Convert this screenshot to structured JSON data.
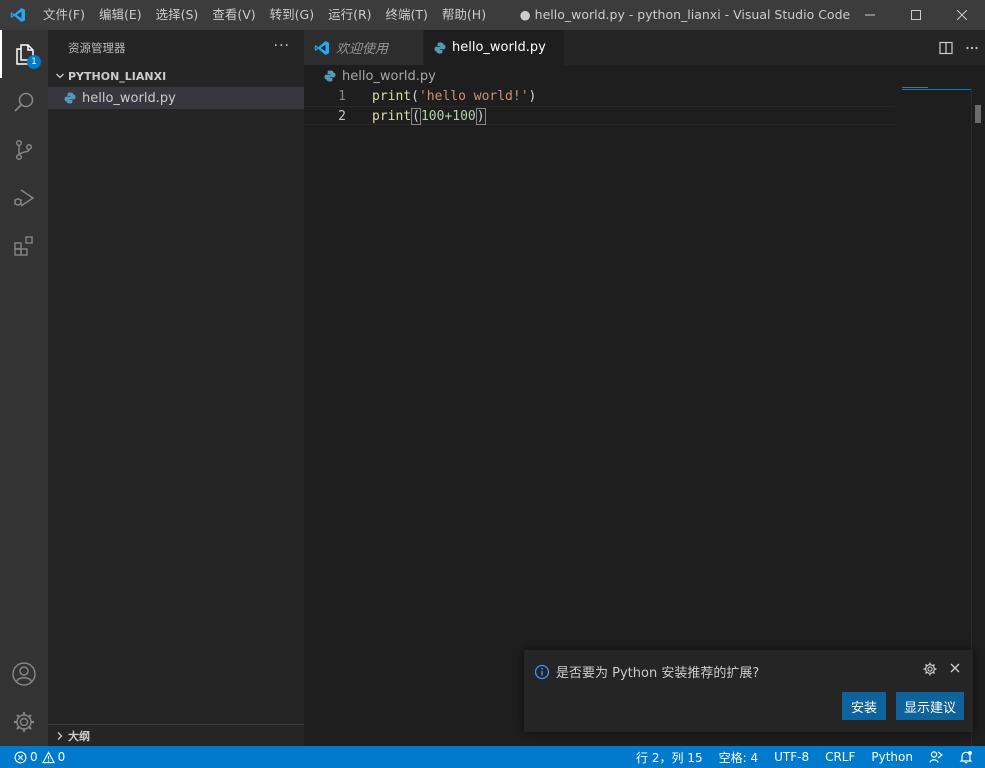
{
  "window": {
    "title": "● hello_world.py - python_lianxi - Visual Studio Code"
  },
  "menu": [
    "文件(F)",
    "编辑(E)",
    "选择(S)",
    "查看(V)",
    "转到(G)",
    "运行(R)",
    "终端(T)",
    "帮助(H)"
  ],
  "activity": {
    "explorer_badge": "1"
  },
  "sidebar": {
    "header": "资源管理器",
    "more": "···",
    "folder": "PYTHON_LIANXI",
    "file": "hello_world.py",
    "outline": "大纲"
  },
  "tabs": [
    {
      "label": "欢迎使用"
    },
    {
      "label": "hello_world.py"
    }
  ],
  "breadcrumb": {
    "file": "hello_world.py"
  },
  "editor": {
    "lines": [
      {
        "num": "1",
        "fn": "print",
        "open": "(",
        "arg": "'hello world!'",
        "close": ")"
      },
      {
        "num": "2",
        "fn": "print",
        "open": "(",
        "arg": "100+100",
        "close": ")"
      }
    ]
  },
  "notification": {
    "message": "是否要为 Python 安装推荐的扩展?",
    "install": "安装",
    "show_suggestions": "显示建议"
  },
  "statusbar": {
    "errors": "0",
    "warnings": "0",
    "position": "行 2，列 15",
    "spaces": "空格: 4",
    "encoding": "UTF-8",
    "eol": "CRLF",
    "language": "Python"
  },
  "colors": {
    "accent": "#007acc",
    "titlebar": "#3c3c3c",
    "activitybar": "#333333",
    "sidebar": "#252526",
    "editor": "#1e1e1e",
    "button": "#0e639c"
  }
}
